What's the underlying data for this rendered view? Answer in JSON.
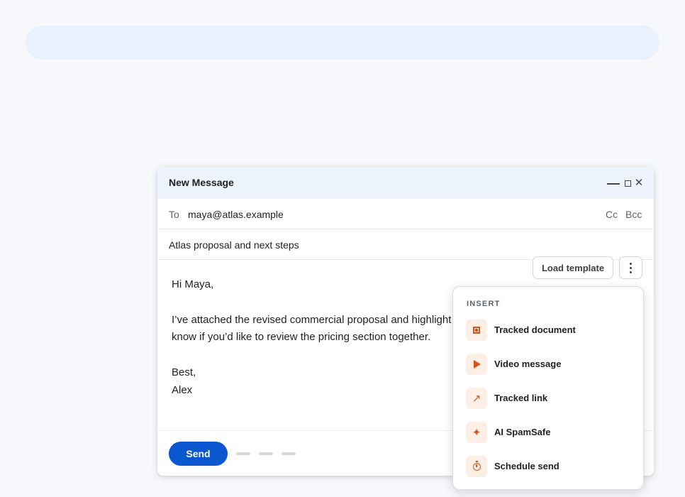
{
  "compose": {
    "title": "New Message",
    "to_label": "To",
    "to_value": "maya@atlas.example",
    "cc_label": "Cc",
    "bcc_label": "Bcc",
    "subject": "Atlas proposal and next steps",
    "load_template_label": "Load template",
    "body": {
      "greeting": "Hi Maya,",
      "paragraph_line1": "I’ve attached the revised commercial proposal and highlight",
      "paragraph_line2": "know if you’d like to review the pricing section together.",
      "signoff": "Best,",
      "signature": "Alex"
    },
    "send_label": "Send"
  },
  "insert_menu": {
    "heading": "INSERT",
    "items": [
      {
        "label": "Tracked document",
        "icon": "tracked-document-icon"
      },
      {
        "label": "Video message",
        "icon": "play-icon"
      },
      {
        "label": "Tracked link",
        "icon": "link-arrow-icon"
      },
      {
        "label": "AI SpamSafe",
        "icon": "sparkle-icon"
      },
      {
        "label": "Schedule send",
        "icon": "stopwatch-icon"
      }
    ]
  },
  "colors": {
    "accent": "#0b57d0",
    "menu_icon_fg": "#d0581f",
    "menu_icon_bg": "#fdeee6",
    "header_bg": "#edf3fd",
    "search_bg": "#e9f1fd",
    "page_bg": "#f6f8fb"
  }
}
